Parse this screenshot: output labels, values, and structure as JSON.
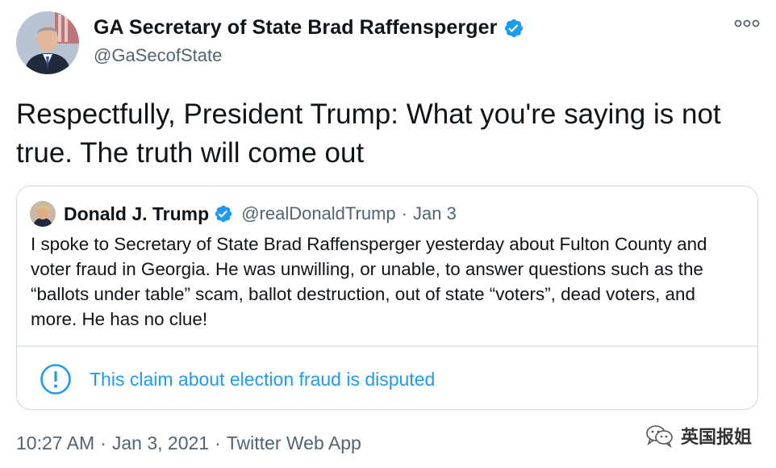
{
  "author": {
    "display_name": "GA Secretary of State Brad Raffensperger",
    "handle": "@GaSecofState",
    "verified": true
  },
  "tweet": {
    "text": "Respectfully, President Trump: What you're saying is not true. The truth will come out"
  },
  "quoted_tweet": {
    "display_name": "Donald J. Trump",
    "handle": "@realDonaldTrump",
    "separator": "·",
    "date": "Jan 3",
    "text": "I spoke to Secretary of State Brad Raffensperger yesterday about Fulton County and voter fraud in Georgia. He was unwilling, or unable, to answer questions such as the “ballots under table” scam, ballot destruction, out of state “voters”, dead voters, and more. He has no clue!",
    "notice": "This claim about election fraud is disputed"
  },
  "footer": {
    "time": "10:27 AM",
    "sep1": "·",
    "date": "Jan 3, 2021",
    "sep2": "·",
    "source": "Twitter Web App"
  },
  "watermark": {
    "text": "英国报姐"
  },
  "colors": {
    "accent": "#1d9bf0",
    "secondary_text": "#536471",
    "primary_text": "#0f1419",
    "border": "#cfd9de"
  },
  "icons": {
    "verified": "verified-badge-icon",
    "more": "more-options-icon",
    "notice": "exclamation-circle-icon",
    "watermark": "wechat-icon"
  }
}
